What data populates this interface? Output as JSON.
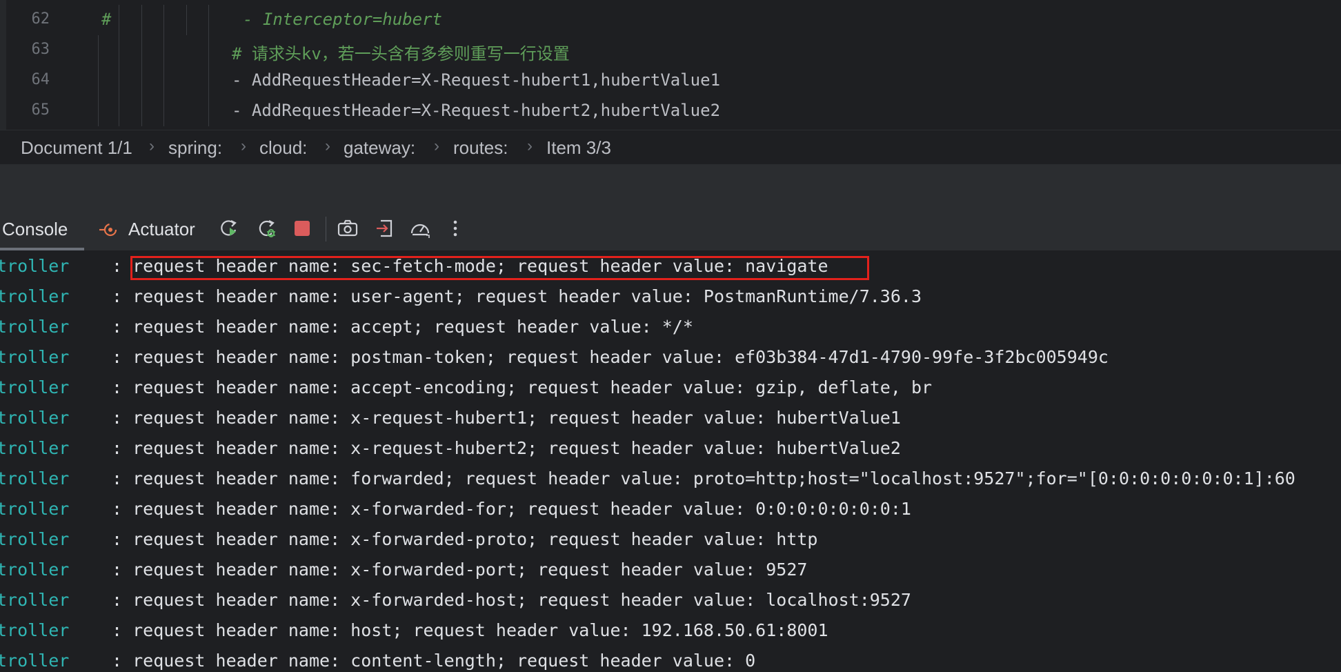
{
  "editor": {
    "lines": [
      {
        "num": "62",
        "hash": "#",
        "text": "- Interceptor=hubert"
      },
      {
        "num": "63",
        "text": "# 请求头kv，若一头含有多参则重写一行设置"
      },
      {
        "num": "64",
        "text": "- AddRequestHeader=X-Request-hubert1,hubertValue1"
      },
      {
        "num": "65",
        "text": "- AddRequestHeader=X-Request-hubert2,hubertValue2"
      }
    ]
  },
  "breadcrumb": [
    "Document 1/1",
    "spring:",
    "cloud:",
    "gateway:",
    "routes:",
    "Item 3/3"
  ],
  "toolbar": {
    "tabs": [
      {
        "label": "Console"
      },
      {
        "label": "Actuator"
      }
    ],
    "icons": [
      "rerun-icon",
      "rerun-debug-icon",
      "stop-icon",
      "screenshot-icon",
      "export-icon",
      "profiler-icon",
      "more-icon"
    ]
  },
  "console": {
    "source": "troller",
    "lines": [
      ": request header name: sec-fetch-mode; request header value: navigate",
      ": request header name: user-agent; request header value: PostmanRuntime/7.36.3",
      ": request header name: accept; request header value: */*",
      ": request header name: postman-token; request header value: ef03b384-47d1-4790-99fe-3f2bc005949c",
      ": request header name: accept-encoding; request header value: gzip, deflate, br",
      ": request header name: x-request-hubert1; request header value: hubertValue1",
      ": request header name: x-request-hubert2; request header value: hubertValue2",
      ": request header name: forwarded; request header value: proto=http;host=\"localhost:9527\";for=\"[0:0:0:0:0:0:0:1]:60",
      ": request header name: x-forwarded-for; request header value: 0:0:0:0:0:0:0:1",
      ": request header name: x-forwarded-proto; request header value: http",
      ": request header name: x-forwarded-port; request header value: 9527",
      ": request header name: x-forwarded-host; request header value: localhost:9527",
      ": request header name: host; request header value: 192.168.50.61:8001",
      ": request header name: content-length; request header value: 0"
    ]
  },
  "colors": {
    "background": "#1e1f22",
    "source_text": "#2fb5b3",
    "comment": "#5f9e59",
    "highlight_box": "#e3211c"
  }
}
